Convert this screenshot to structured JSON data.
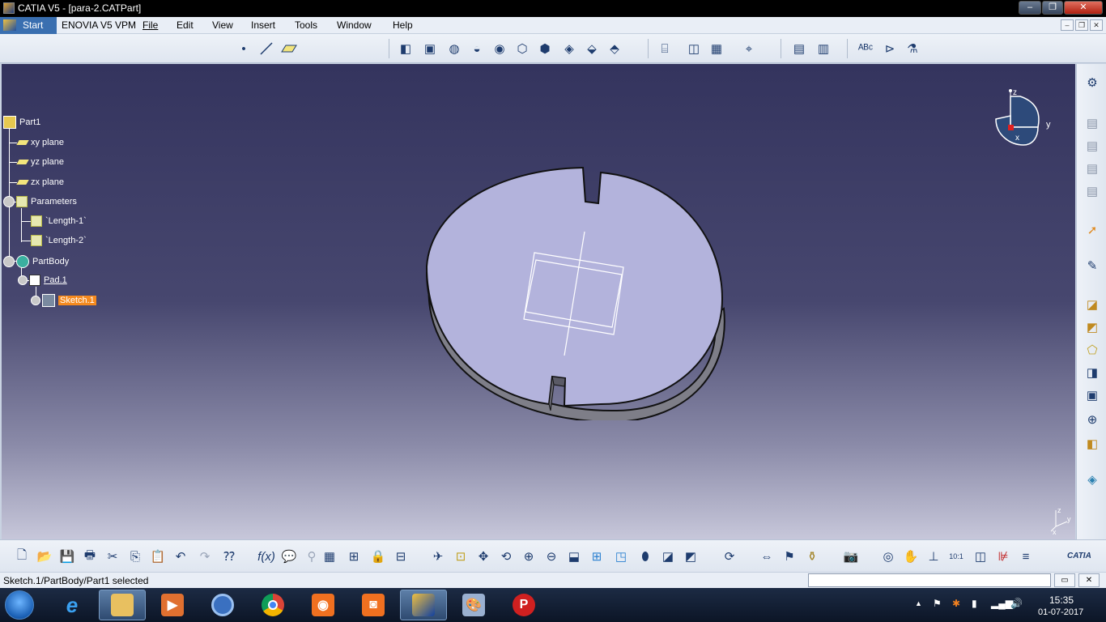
{
  "window": {
    "title": "CATIA V5 - [para-2.CATPart]",
    "minimize_glyph": "–",
    "restore_glyph": "❐",
    "close_glyph": "✕"
  },
  "menubar": {
    "items": [
      "Start",
      "ENOVIA V5 VPM",
      "File",
      "Edit",
      "View",
      "Insert",
      "Tools",
      "Window",
      "Help"
    ],
    "mdi_min": "–",
    "mdi_restore": "❐",
    "mdi_close": "✕"
  },
  "tree": {
    "root": "Part1",
    "planes": [
      "xy plane",
      "yz plane",
      "zx plane"
    ],
    "parameters_label": "Parameters",
    "parameters": [
      "`Length-1`",
      "`Length-2`"
    ],
    "body": "PartBody",
    "pad": "Pad.1",
    "sketch": "Sketch.1"
  },
  "compass": {
    "x_label": "x",
    "y_label": "y",
    "z_label": "z"
  },
  "axis_triad": {
    "x_label": "x",
    "y_label": "y",
    "z_label": "z"
  },
  "statusbar": {
    "status_text": "Sketch.1/PartBody/Part1 selected",
    "command_value": ""
  },
  "bottom_logo": "CATIA",
  "taskbar": {
    "time": "15:35",
    "date": "01-07-2017",
    "tray_arrow": "▲"
  },
  "colors": {
    "viewport_top": "#34345e",
    "viewport_bottom": "#c7c7da",
    "part_face": "#b3b3dc",
    "part_side": "#7e7e88",
    "selected_highlight": "#f58a1f"
  }
}
